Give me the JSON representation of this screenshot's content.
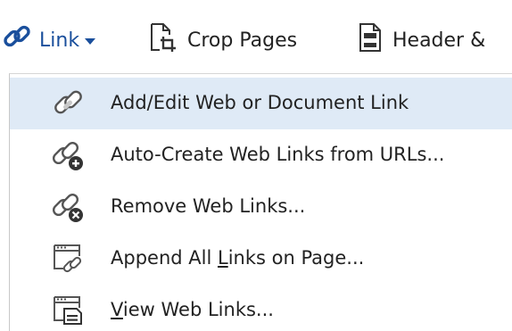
{
  "toolbar": {
    "link": {
      "label": "Link",
      "icon": "link-icon",
      "color": "#1a4f9c"
    },
    "crop": {
      "label": "Crop Pages",
      "icon": "crop-pages-icon"
    },
    "header": {
      "label": "Header &",
      "icon": "header-footer-icon"
    }
  },
  "menu": {
    "highlight_color": "#dfeaf6",
    "items": [
      {
        "label": "Add/Edit Web or Document Link",
        "icon": "chain-link-icon",
        "highlighted": true
      },
      {
        "label": "Auto-Create Web Links from URLs...",
        "icon": "chain-link-plus-icon"
      },
      {
        "label": "Remove Web Links...",
        "icon": "chain-link-remove-icon"
      },
      {
        "label_pre": "Append All ",
        "label_mnemonic": "L",
        "label_post": "inks on Page...",
        "icon": "window-link-icon"
      },
      {
        "label_pre": "",
        "label_mnemonic": "V",
        "label_post": "iew Web Links...",
        "icon": "window-list-icon"
      }
    ]
  }
}
